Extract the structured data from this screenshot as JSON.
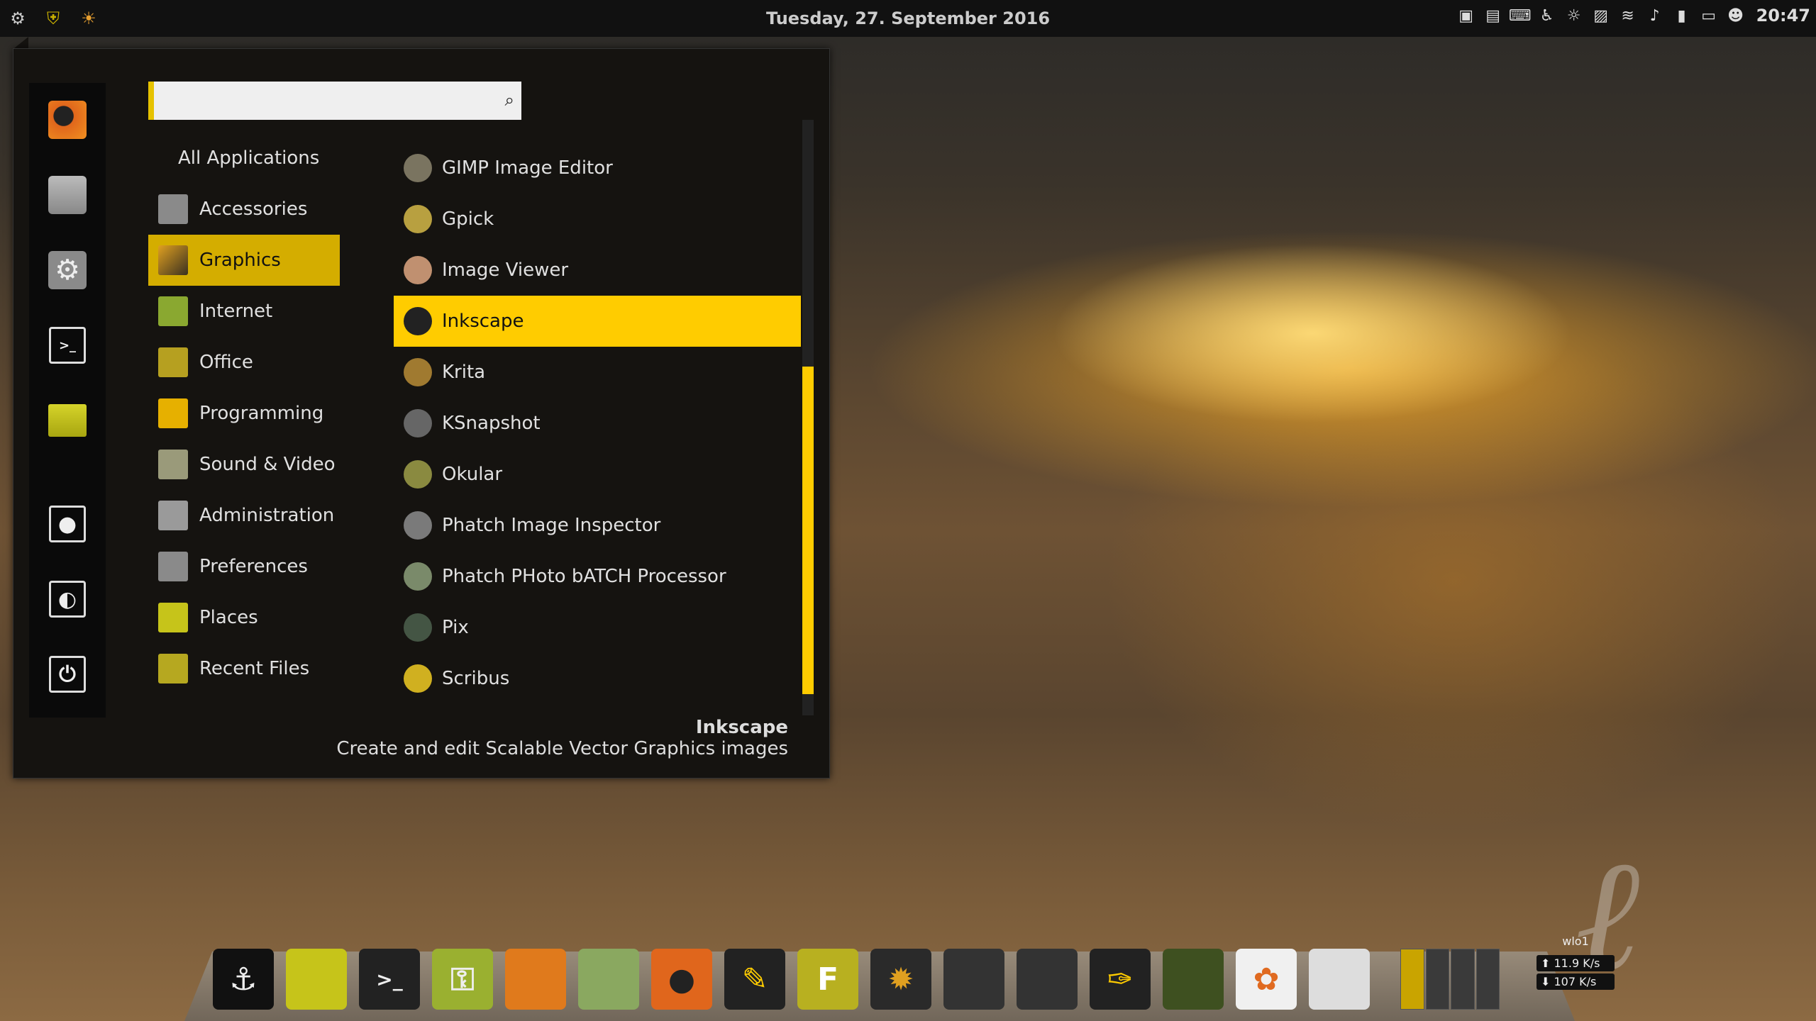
{
  "top_panel": {
    "left_icons": [
      "gear-icon",
      "shield-icon",
      "weather-icon"
    ],
    "date": "Tuesday, 27. September 2016",
    "time": "20:47",
    "tray_icons": [
      "screen-icon",
      "keyboard-indicator-icon",
      "keyboard-icon",
      "accessibility-icon",
      "brightness-icon",
      "clipboard-icon",
      "wifi-icon",
      "volume-icon",
      "battery-icon",
      "display-icon",
      "user-icon"
    ]
  },
  "menu": {
    "search": {
      "value": "",
      "placeholder": ""
    },
    "favorites": [
      {
        "name": "firefox",
        "color": "#e0661c"
      },
      {
        "name": "software-manager",
        "color": "#9a9a9a"
      },
      {
        "name": "system-settings",
        "color": "#8a8a8a"
      },
      {
        "name": "terminal",
        "color": "#222222"
      },
      {
        "name": "files",
        "color": "#c6c41a"
      }
    ],
    "session": [
      {
        "name": "lock-screen",
        "icon": "lock-icon"
      },
      {
        "name": "logout",
        "icon": "logout-icon"
      },
      {
        "name": "shutdown",
        "icon": "power-icon"
      }
    ],
    "categories": [
      {
        "label": "All Applications",
        "color": ""
      },
      {
        "label": "Accessories",
        "color": "#8a8a8a"
      },
      {
        "label": "Graphics",
        "color": "#8b6a2a",
        "active": true
      },
      {
        "label": "Internet",
        "color": "#8aa830"
      },
      {
        "label": "Office",
        "color": "#b6a020"
      },
      {
        "label": "Programming",
        "color": "#e6b000"
      },
      {
        "label": "Sound & Video",
        "color": "#9a9a7a"
      },
      {
        "label": "Administration",
        "color": "#9a9a9a"
      },
      {
        "label": "Preferences",
        "color": "#8a8a8a"
      },
      {
        "label": "Places",
        "color": "#c6c41a"
      },
      {
        "label": "Recent Files",
        "color": "#b6a820"
      }
    ],
    "apps": [
      {
        "label": "GIMP Image Editor",
        "color": "#7a7460"
      },
      {
        "label": "Gpick",
        "color": "#b8a040"
      },
      {
        "label": "Image Viewer",
        "color": "#c09070"
      },
      {
        "label": "Inkscape",
        "color": "#222222",
        "active": true
      },
      {
        "label": "Krita",
        "color": "#a07a30"
      },
      {
        "label": "KSnapshot",
        "color": "#666666"
      },
      {
        "label": "Okular",
        "color": "#8a8a40"
      },
      {
        "label": "Phatch Image Inspector",
        "color": "#7a7a7a"
      },
      {
        "label": "Phatch PHoto bATCH Processor",
        "color": "#7a8a6a"
      },
      {
        "label": "Pix",
        "color": "#445544"
      },
      {
        "label": "Scribus",
        "color": "#d0b020"
      }
    ],
    "description": {
      "title": "Inkscape",
      "text": "Create and edit Scalable Vector Graphics images"
    }
  },
  "dock": {
    "items": [
      {
        "name": "anchor",
        "glyph": "⚓",
        "bg": "#111111",
        "fg": "#eeeeee"
      },
      {
        "name": "files",
        "glyph": "",
        "bg": "#c6c41a",
        "fg": "#000000"
      },
      {
        "name": "terminal",
        "glyph": ">_",
        "bg": "#222222",
        "fg": "#eeeeee"
      },
      {
        "name": "passwords",
        "glyph": "🔑",
        "bg": "#9ab030",
        "fg": "#eeeeee"
      },
      {
        "name": "firefox",
        "glyph": "",
        "bg": "#e07a1c",
        "fg": "#000000"
      },
      {
        "name": "mail",
        "glyph": "",
        "bg": "#8aa860",
        "fg": "#000000"
      },
      {
        "name": "chrome",
        "glyph": "●",
        "bg": "#e0661c",
        "fg": "#222222"
      },
      {
        "name": "writer",
        "glyph": "✎",
        "bg": "#222222",
        "fg": "#ffcc00"
      },
      {
        "name": "fontforge",
        "glyph": "F",
        "bg": "#b8b020",
        "fg": "#ffffff"
      },
      {
        "name": "darktable",
        "glyph": "✹",
        "bg": "#2a2a2a",
        "fg": "#e0a020"
      },
      {
        "name": "inkscape",
        "glyph": "",
        "bg": "#333333",
        "fg": "#eeeeee"
      },
      {
        "name": "gimp",
        "glyph": "",
        "bg": "#333333",
        "fg": "#cccccc"
      },
      {
        "name": "gpick",
        "glyph": "✑",
        "bg": "#222222",
        "fg": "#ffcc00"
      },
      {
        "name": "plant",
        "glyph": "",
        "bg": "#3e5020",
        "fg": "#a0c030"
      },
      {
        "name": "photos",
        "glyph": "✿",
        "bg": "#f0f0f0",
        "fg": "#e06a20"
      },
      {
        "name": "security",
        "glyph": "",
        "bg": "#dddddd",
        "fg": "#aaaaaa"
      }
    ],
    "workspaces": [
      true,
      false,
      false,
      false
    ],
    "netmon": {
      "iface": "wlo1",
      "up": "11.9 K/s",
      "down": "107 K/s"
    }
  }
}
